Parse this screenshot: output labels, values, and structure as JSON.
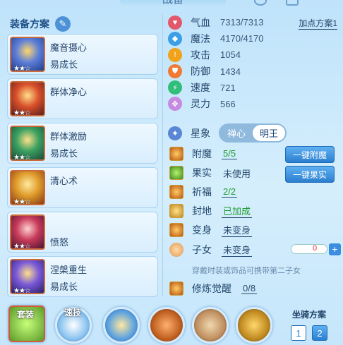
{
  "title": "战备",
  "left": {
    "header": "装备方案",
    "cards": [
      {
        "name": "魔音摄心",
        "sub": "易成长",
        "stars": "★★☆"
      },
      {
        "name": "群体净心",
        "sub": "",
        "stars": "★★☆"
      },
      {
        "name": "群体激励",
        "sub": "易成长",
        "stars": "★★☆"
      },
      {
        "name": "清心术",
        "sub": "",
        "stars": "★★☆"
      },
      {
        "name": "",
        "sub": "愤怒",
        "stars": "★★☆"
      },
      {
        "name": "涅槃重生",
        "sub": "易成长",
        "stars": "★★☆"
      }
    ]
  },
  "stats": [
    {
      "k": "气血",
      "v": "7313/7313",
      "color": "#e2586a",
      "icon": "heart-icon"
    },
    {
      "k": "魔法",
      "v": "4170/4170",
      "color": "#3b9ee6",
      "icon": "diamond-icon"
    },
    {
      "k": "攻击",
      "v": "1054",
      "color": "#f0a21b",
      "icon": "attack-icon"
    },
    {
      "k": "防御",
      "v": "1434",
      "color": "#f27a35",
      "icon": "shield-icon"
    },
    {
      "k": "速度",
      "v": "721",
      "color": "#2fbf7b",
      "icon": "speed-icon"
    },
    {
      "k": "灵力",
      "v": "566",
      "color": "#c58be0",
      "icon": "spirit-icon"
    }
  ],
  "plan_link": "加点方案1",
  "xingxiang": {
    "label": "星象",
    "opt1": "禅心",
    "opt2": "明王"
  },
  "rows": [
    {
      "k": "附魔",
      "v": "5/5",
      "vcolor": "#1f9c30",
      "btn": "一键附魔"
    },
    {
      "k": "果实",
      "v": "未使用",
      "vcolor": "#2a4a6e",
      "btn": "一键果实"
    },
    {
      "k": "祈福",
      "v": "2/2",
      "vcolor": "#1f9c30",
      "btn": ""
    },
    {
      "k": "封地",
      "v": "已加成",
      "vcolor": "#1f9c30",
      "btn": ""
    },
    {
      "k": "变身",
      "v": "未变身",
      "vcolor": "#2a4a6e",
      "btn": ""
    },
    {
      "k": "子女",
      "v": "未变身",
      "vcolor": "#2a4a6e",
      "btn": ""
    }
  ],
  "child_value": "0",
  "hint": "穿戴时装或饰品可携带第二子女",
  "cultivation": {
    "k": "修炼觉醒",
    "v": "0/8"
  },
  "bottom": {
    "suit": "套装",
    "skill": "速技",
    "mount_label": "坐骑方案",
    "mount1": "1",
    "mount2": "2"
  }
}
